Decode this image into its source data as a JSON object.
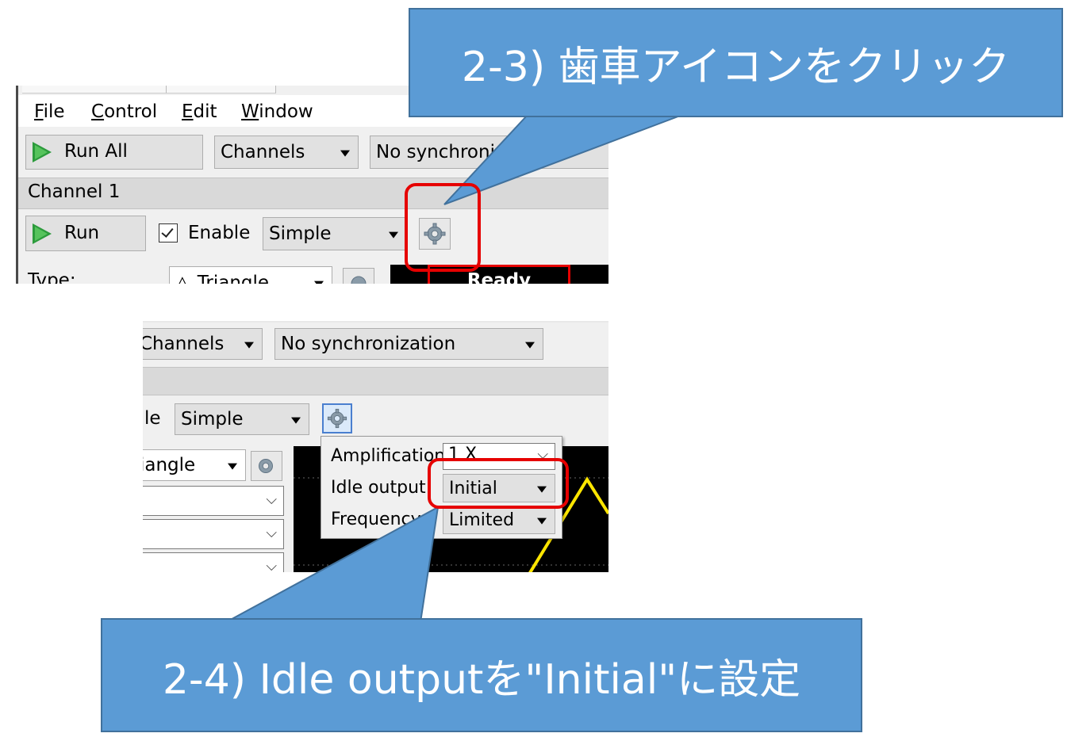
{
  "callouts": {
    "top": "2-3) 歯車アイコンをクリック",
    "bottom": "2-4) Idle outputを\"Initial\"に設定"
  },
  "top_panel": {
    "menu": [
      {
        "hotkey": "F",
        "rest": "ile"
      },
      {
        "hotkey": "C",
        "rest": "ontrol"
      },
      {
        "hotkey": "E",
        "rest": "dit"
      },
      {
        "hotkey": "W",
        "rest": "indow"
      }
    ],
    "run_all_label": "Run All",
    "channels_select": "Channels",
    "sync_select": "No synchroni",
    "channel_header": "Channel 1",
    "run_label": "Run",
    "enable_label": "Enable",
    "enable_checked": true,
    "mode_select": "Simple",
    "type_label": "Type:",
    "type_select": "Triangle",
    "status_text": "Ready"
  },
  "bottom_panel": {
    "channels_select": "Channels",
    "sync_select": "No synchronization",
    "enable_partial": "le",
    "mode_select": "Simple",
    "type_partial": "iangle",
    "popup": {
      "amplification_label": "Amplification:",
      "amplification_value": "1 X",
      "idle_output_label": "Idle output:",
      "idle_output_value": "Initial",
      "frequency_label": "Frequency:",
      "frequency_value": "Limited"
    }
  },
  "colors": {
    "callout_fill": "#5b9bd5",
    "highlight": "#e60000",
    "trace": "#ffe600",
    "plot_bg": "#000000"
  }
}
